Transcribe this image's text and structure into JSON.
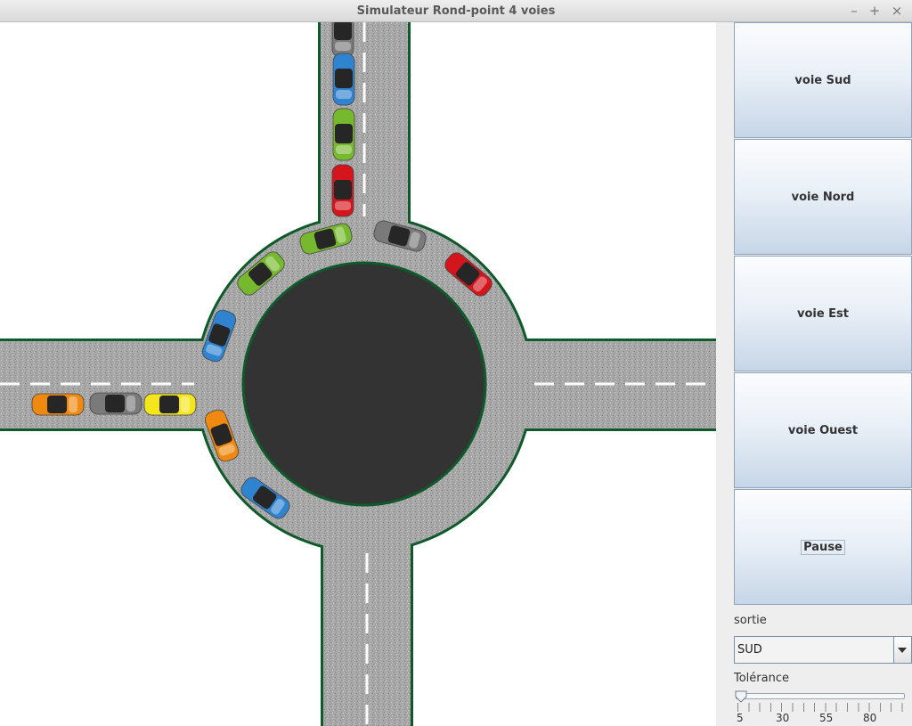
{
  "window": {
    "title": "Simulateur Rond-point 4 voies",
    "controls": [
      "–",
      "+",
      "×"
    ]
  },
  "panel": {
    "buttons": [
      "voie Sud",
      "voie Nord",
      "voie Est",
      "voie Ouest"
    ],
    "pause": "Pause",
    "sortie_label": "sortie",
    "sortie_value": "SUD",
    "tolerance_label": "Tolérance",
    "tolerance_value": 5,
    "tolerance_ticks": [
      "5",
      "30",
      "55",
      "80"
    ]
  },
  "colors": {
    "road": "#a9a9a9",
    "island": "#333333",
    "border": "#0f5a2a",
    "cars": {
      "gray": "#7a7a7a",
      "blue": "#2f83cf",
      "green": "#77b92e",
      "red": "#d4151c",
      "orange": "#f0890f",
      "yellow": "#f5e51c"
    }
  },
  "cars": [
    "gray",
    "blue",
    "green",
    "red",
    "green",
    "green",
    "gray",
    "red",
    "blue",
    "orange",
    "gray",
    "yellow",
    "orange",
    "blue"
  ]
}
